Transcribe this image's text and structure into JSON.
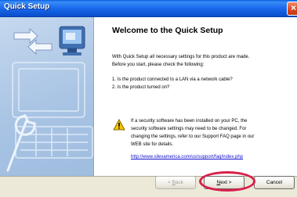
{
  "window": {
    "title": "Quick Setup"
  },
  "content": {
    "heading": "Welcome to the Quick Setup",
    "intro_line1": "With Quick Setup all necessary settings for this product are made.",
    "intro_line2": "Before you start, please check the following:",
    "check1": "1. Is the product connected to a LAN via a network cable?",
    "check2": "2. Is the product turned on?",
    "warning_lines": [
      "If a security software has been installed on your PC, the",
      "security software settings may need to be changed. For",
      "changing the settings, refer to our Support FAQ page in our",
      "WEB site for details."
    ],
    "link": "http://www.silexamerica.com/us/support/faq/index.php"
  },
  "buttons": {
    "back": {
      "prefix": "< ",
      "key": "B",
      "rest": "ack"
    },
    "next": {
      "key": "N",
      "rest": "ext >"
    },
    "cancel": "Cancel"
  },
  "colors": {
    "titlebar": "#1d6df0",
    "side_panel": "#a9c4e4",
    "link": "#1010cc",
    "highlight_ring": "#d81e4a",
    "warning_icon": "#f5c400"
  },
  "icons": [
    "window-close-icon",
    "connection-arrows-icon",
    "monitor-icon",
    "wrench-icon",
    "computer-outline-icon",
    "warning-icon"
  ]
}
